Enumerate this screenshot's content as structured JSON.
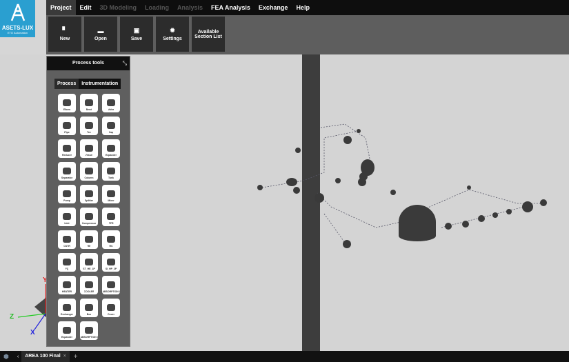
{
  "logo": {
    "name": "ASETS-LUX",
    "tagline": "ETO Automation"
  },
  "menu": [
    {
      "label": "Project",
      "state": "active"
    },
    {
      "label": "Edit",
      "state": "normal"
    },
    {
      "label": "3D Modeling",
      "state": "disabled"
    },
    {
      "label": "Loading",
      "state": "disabled"
    },
    {
      "label": "Analysis",
      "state": "disabled"
    },
    {
      "label": "FEA Analysis",
      "state": "normal"
    },
    {
      "label": "Exchange",
      "state": "normal"
    },
    {
      "label": "Help",
      "state": "normal"
    }
  ],
  "ribbon": [
    {
      "label": "New",
      "icon": "file-icon"
    },
    {
      "label": "Open",
      "icon": "folder-icon"
    },
    {
      "label": "Save",
      "icon": "save-icon"
    },
    {
      "label": "Settings",
      "icon": "gear-icon"
    },
    {
      "label": "Available Section List",
      "icon": ""
    }
  ],
  "panel": {
    "title": "Process tools",
    "tabs": [
      "Process",
      "Instrumentation"
    ],
    "tools": [
      "Elbow",
      "Bend",
      "Valve",
      "Pipe",
      "Tee",
      "Cap",
      "Reducer",
      "Vessel",
      "Expander",
      "Separator",
      "Column",
      "Tank",
      "Pump",
      "Splitter",
      "Mixer",
      "Inlet",
      "Compressor",
      "PFR",
      "CSTR",
      "RE",
      "RC",
      "FQ",
      "ST_HE_1P",
      "SI_HP_2P",
      "HEATER",
      "COOLER",
      "ABSORPTION COLUMN",
      "Exchanger",
      "Box",
      "Cover",
      "Expander",
      "ABSORPTION COLUMN"
    ]
  },
  "axes": {
    "x": "X",
    "y": "Y",
    "z": "Z"
  },
  "statusbar": {
    "tab": "AREA 100 Final",
    "close": "×",
    "add": "+",
    "back": "‹"
  }
}
